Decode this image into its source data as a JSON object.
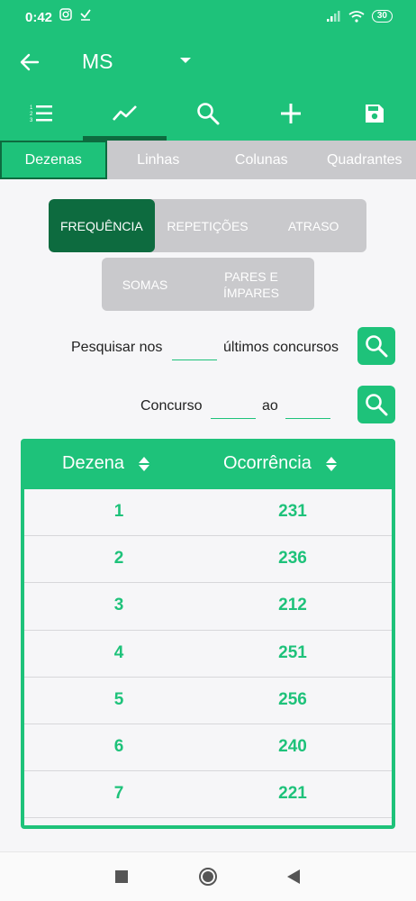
{
  "status_bar": {
    "time": "0:42",
    "battery": "30"
  },
  "app_bar": {
    "title": "MS"
  },
  "toolbar": {
    "items": [
      {
        "icon": "list-numbered-icon"
      },
      {
        "icon": "trending-icon",
        "active": true
      },
      {
        "icon": "search-icon"
      },
      {
        "icon": "add-icon"
      },
      {
        "icon": "save-icon"
      }
    ]
  },
  "subtabs": [
    "Dezenas",
    "Linhas",
    "Colunas",
    "Quadrantes"
  ],
  "segments_row1": [
    "FREQUÊNCIA",
    "REPETIÇÕES",
    "ATRASO"
  ],
  "segments_row2": [
    "SOMAS",
    "PARES E ÍMPARES"
  ],
  "search": {
    "last_prefix": "Pesquisar nos",
    "last_suffix": "últimos concursos",
    "last_value": "",
    "range_prefix": "Concurso",
    "range_mid": "ao",
    "range_from": "",
    "range_to": ""
  },
  "table": {
    "headers": [
      "Dezena",
      "Ocorrência"
    ],
    "rows": [
      {
        "dezena": "1",
        "ocorrencia": "231"
      },
      {
        "dezena": "2",
        "ocorrencia": "236"
      },
      {
        "dezena": "3",
        "ocorrencia": "212"
      },
      {
        "dezena": "4",
        "ocorrencia": "251"
      },
      {
        "dezena": "5",
        "ocorrencia": "256"
      },
      {
        "dezena": "6",
        "ocorrencia": "240"
      },
      {
        "dezena": "7",
        "ocorrencia": "221"
      }
    ]
  },
  "colors": {
    "accent": "#1ec27a",
    "dark_accent": "#0d6b3f",
    "inactive": "#c9c9cc"
  }
}
